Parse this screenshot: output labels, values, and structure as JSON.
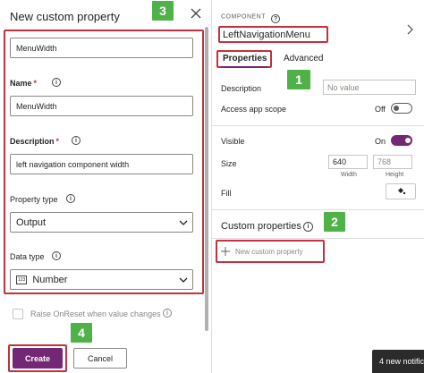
{
  "left_panel": {
    "title": "New custom property",
    "display_name_value": "MenuWidth",
    "name_label": "Name",
    "name_value": "MenuWidth",
    "description_label": "Description",
    "description_value": "left navigation component width",
    "property_type_label": "Property type",
    "property_type_value": "Output",
    "data_type_label": "Data type",
    "data_type_value": "Number",
    "data_type_icon_text": "123",
    "raise_onreset_label": "Raise OnReset when value changes",
    "required_mark": "*",
    "info_glyph": "i",
    "create_label": "Create",
    "cancel_label": "Cancel"
  },
  "right_panel": {
    "component_caption": "COMPONENT",
    "component_name": "LeftNavigationMenu",
    "tabs": [
      {
        "label": "Properties",
        "active": true
      },
      {
        "label": "Advanced",
        "active": false
      }
    ],
    "description_label": "Description",
    "description_placeholder": "No value",
    "access_scope_label": "Access app scope",
    "access_scope_state": "Off",
    "visible_label": "Visible",
    "visible_state": "On",
    "size_label": "Size",
    "width_value": "640",
    "height_value": "768",
    "width_label": "Width",
    "height_label": "Height",
    "fill_label": "Fill",
    "custom_properties_title": "Custom properties",
    "new_custom_property_label": "New custom property"
  },
  "annotations": {
    "badge_1": "1",
    "badge_2": "2",
    "badge_3": "3",
    "badge_4": "4"
  },
  "toast": {
    "text": "4 new notific"
  },
  "colors": {
    "accent": "#742774",
    "highlight_border": "#c4303d",
    "badge": "#4fb248",
    "toggle_on": "#742774"
  },
  "icons": [
    "close-icon",
    "info-icon",
    "chevron-down-icon",
    "chevron-right-icon",
    "plus-icon",
    "paint-bucket-icon",
    "number-type-icon"
  ]
}
